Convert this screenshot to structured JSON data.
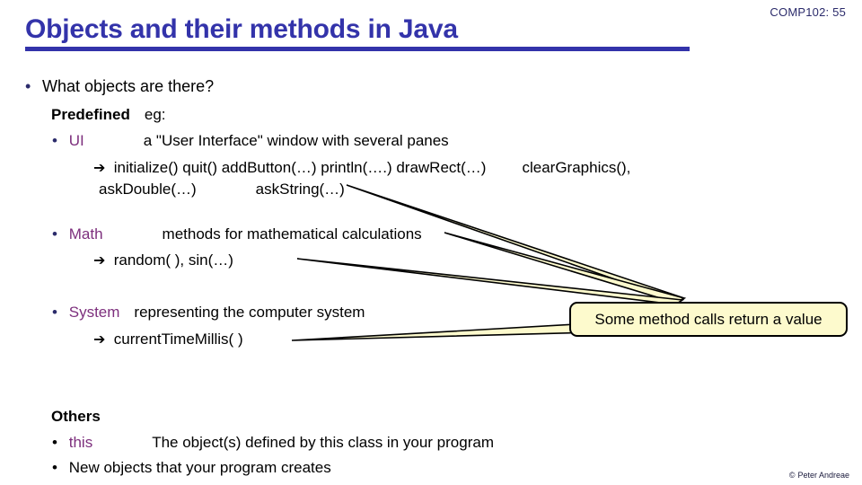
{
  "header": {
    "slide_number": "COMP102: 55",
    "title": "Objects and their methods in Java"
  },
  "body": {
    "q_objects": "What objects are there?",
    "predefined_label": "Predefined",
    "predefined_eg": "eg:",
    "ui_keyword": "UI",
    "ui_desc": "a \"User Interface\" window with several panes",
    "ui_methods_1": "initialize()    quit()    addButton(…)  println(….)  drawRect(…)",
    "ui_methods_1b": "clearGraphics(),",
    "ui_methods_2": "askDouble(…)",
    "ui_methods_2b": "askString(…)",
    "math_keyword": "Math",
    "math_desc": "methods for mathematical calculations",
    "math_methods": "random( ),  sin(…)",
    "system_keyword": "System",
    "system_desc": "representing the computer system",
    "system_methods": "currentTimeMillis( )",
    "others_label": "Others",
    "this_keyword": "this",
    "this_desc": "The object(s) defined by this class in your program",
    "new_objects": "New objects that your program creates"
  },
  "callout": {
    "text": "Some method calls return a value",
    "fill_color": "#fdfacd",
    "border_color": "#000000"
  },
  "footer": {
    "glyph": "©",
    "credit": "Peter Andreae"
  },
  "colors": {
    "title": "#3333aa",
    "keyword_purple": "#7d2f7d",
    "bullet": "#2b2b6b"
  }
}
